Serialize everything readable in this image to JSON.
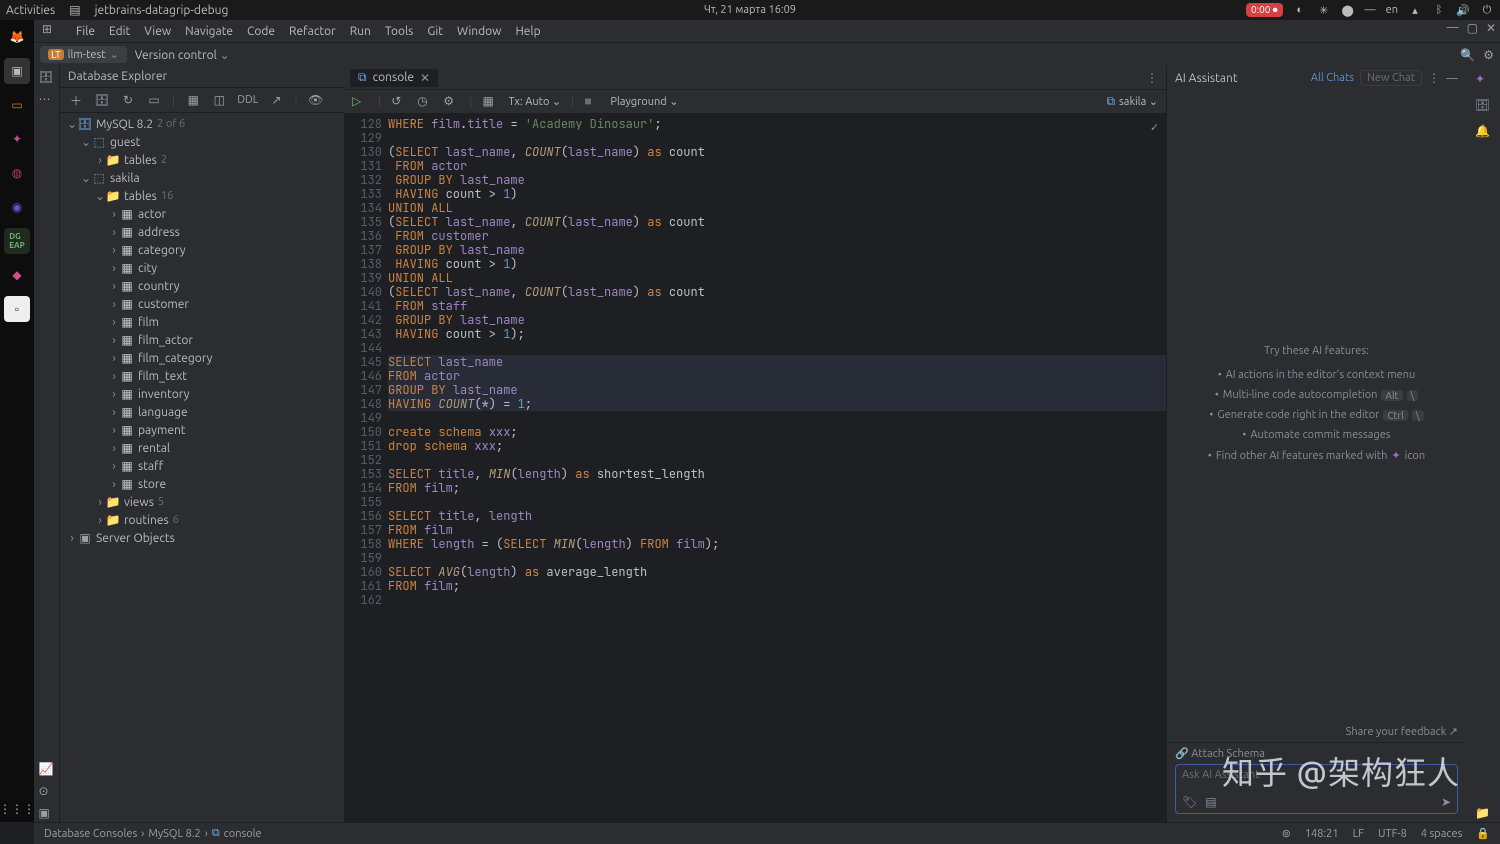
{
  "sysbar": {
    "activities": "Activities",
    "app_title": "jetbrains-datagrip-debug",
    "date": "Чт, 21 марта  16:09",
    "rec": "0:00",
    "lang": "en"
  },
  "menubar": [
    "File",
    "Edit",
    "View",
    "Navigate",
    "Code",
    "Refactor",
    "Run",
    "Tools",
    "Git",
    "Window",
    "Help"
  ],
  "navbar": {
    "project": "llm-test",
    "vcs": "Version control"
  },
  "dbexp": {
    "title": "Database Explorer",
    "tool_ddl": "DDL",
    "root": {
      "label": "MySQL 8.2",
      "suffix": "2 of 6"
    },
    "guest": {
      "label": "guest",
      "tables": {
        "label": "tables",
        "count": "2"
      }
    },
    "sakila": {
      "label": "sakila",
      "tables_label": "tables",
      "tables_count": "16",
      "tables": [
        "actor",
        "address",
        "category",
        "city",
        "country",
        "customer",
        "film",
        "film_actor",
        "film_category",
        "film_text",
        "inventory",
        "language",
        "payment",
        "rental",
        "staff",
        "store"
      ],
      "views": {
        "label": "views",
        "count": "5"
      },
      "routines": {
        "label": "routines",
        "count": "6"
      }
    },
    "server_objects": "Server Objects"
  },
  "editor": {
    "tab": "console",
    "tx": "Tx: Auto",
    "playground": "Playground",
    "session": "sakila"
  },
  "code": {
    "start": 128,
    "lines": [
      [
        [
          "kw",
          "WHERE"
        ],
        [
          "op",
          " "
        ],
        [
          "id",
          "film"
        ],
        [
          "op",
          "."
        ],
        [
          "id",
          "title"
        ],
        [
          "op",
          " = "
        ],
        [
          "str",
          "'Academy Dinosaur'"
        ],
        [
          "op",
          ";"
        ]
      ],
      [],
      [
        [
          "op",
          "("
        ],
        [
          "kw",
          "SELECT"
        ],
        [
          "op",
          " "
        ],
        [
          "id",
          "last_name"
        ],
        [
          "op",
          ", "
        ],
        [
          "fn",
          "COUNT"
        ],
        [
          "op",
          "("
        ],
        [
          "id",
          "last_name"
        ],
        [
          "op",
          ") "
        ],
        [
          "kw",
          "as"
        ],
        [
          "op",
          " count"
        ]
      ],
      [
        [
          "op",
          " "
        ],
        [
          "kw",
          "FROM"
        ],
        [
          "op",
          " "
        ],
        [
          "id",
          "actor"
        ]
      ],
      [
        [
          "op",
          " "
        ],
        [
          "kw",
          "GROUP BY"
        ],
        [
          "op",
          " "
        ],
        [
          "id",
          "last_name"
        ]
      ],
      [
        [
          "op",
          " "
        ],
        [
          "kw",
          "HAVING"
        ],
        [
          "op",
          " count > "
        ],
        [
          "num",
          "1"
        ],
        [
          "op",
          ")"
        ]
      ],
      [
        [
          "kw",
          "UNION ALL"
        ]
      ],
      [
        [
          "op",
          "("
        ],
        [
          "kw",
          "SELECT"
        ],
        [
          "op",
          " "
        ],
        [
          "id",
          "last_name"
        ],
        [
          "op",
          ", "
        ],
        [
          "fn",
          "COUNT"
        ],
        [
          "op",
          "("
        ],
        [
          "id",
          "last_name"
        ],
        [
          "op",
          ") "
        ],
        [
          "kw",
          "as"
        ],
        [
          "op",
          " count"
        ]
      ],
      [
        [
          "op",
          " "
        ],
        [
          "kw",
          "FROM"
        ],
        [
          "op",
          " "
        ],
        [
          "id",
          "customer"
        ]
      ],
      [
        [
          "op",
          " "
        ],
        [
          "kw",
          "GROUP BY"
        ],
        [
          "op",
          " "
        ],
        [
          "id",
          "last_name"
        ]
      ],
      [
        [
          "op",
          " "
        ],
        [
          "kw",
          "HAVING"
        ],
        [
          "op",
          " count > "
        ],
        [
          "num",
          "1"
        ],
        [
          "op",
          ")"
        ]
      ],
      [
        [
          "kw",
          "UNION ALL"
        ]
      ],
      [
        [
          "op",
          "("
        ],
        [
          "kw",
          "SELECT"
        ],
        [
          "op",
          " "
        ],
        [
          "id",
          "last_name"
        ],
        [
          "op",
          ", "
        ],
        [
          "fn",
          "COUNT"
        ],
        [
          "op",
          "("
        ],
        [
          "id",
          "last_name"
        ],
        [
          "op",
          ") "
        ],
        [
          "kw",
          "as"
        ],
        [
          "op",
          " count"
        ]
      ],
      [
        [
          "op",
          " "
        ],
        [
          "kw",
          "FROM"
        ],
        [
          "op",
          " "
        ],
        [
          "id",
          "staff"
        ]
      ],
      [
        [
          "op",
          " "
        ],
        [
          "kw",
          "GROUP BY"
        ],
        [
          "op",
          " "
        ],
        [
          "id",
          "last_name"
        ]
      ],
      [
        [
          "op",
          " "
        ],
        [
          "kw",
          "HAVING"
        ],
        [
          "op",
          " count > "
        ],
        [
          "num",
          "1"
        ],
        [
          "op",
          ");"
        ]
      ],
      [],
      [
        [
          "kw",
          "SELECT"
        ],
        [
          "op",
          " "
        ],
        [
          "id",
          "last_name"
        ]
      ],
      [
        [
          "kw",
          "FROM"
        ],
        [
          "op",
          " "
        ],
        [
          "id",
          "actor"
        ]
      ],
      [
        [
          "kw",
          "GROUP BY"
        ],
        [
          "op",
          " "
        ],
        [
          "id",
          "last_name"
        ]
      ],
      [
        [
          "kw",
          "HAVING"
        ],
        [
          "op",
          " "
        ],
        [
          "fn",
          "COUNT"
        ],
        [
          "op",
          "(*) = "
        ],
        [
          "num",
          "1"
        ],
        [
          "op",
          ";"
        ]
      ],
      [],
      [
        [
          "kw",
          "create schema"
        ],
        [
          "op",
          " "
        ],
        [
          "id",
          "xxx"
        ],
        [
          "op",
          ";"
        ]
      ],
      [
        [
          "kw",
          "drop schema"
        ],
        [
          "op",
          " "
        ],
        [
          "id",
          "xxx"
        ],
        [
          "op",
          ";"
        ]
      ],
      [],
      [
        [
          "kw",
          "SELECT"
        ],
        [
          "op",
          " "
        ],
        [
          "id",
          "title"
        ],
        [
          "op",
          ", "
        ],
        [
          "fn",
          "MIN"
        ],
        [
          "op",
          "("
        ],
        [
          "id",
          "length"
        ],
        [
          "op",
          ") "
        ],
        [
          "kw",
          "as"
        ],
        [
          "op",
          " shortest_length"
        ]
      ],
      [
        [
          "kw",
          "FROM"
        ],
        [
          "op",
          " "
        ],
        [
          "id",
          "film"
        ],
        [
          "op",
          ";"
        ]
      ],
      [],
      [
        [
          "kw",
          "SELECT"
        ],
        [
          "op",
          " "
        ],
        [
          "id",
          "title"
        ],
        [
          "op",
          ", "
        ],
        [
          "id",
          "length"
        ]
      ],
      [
        [
          "kw",
          "FROM"
        ],
        [
          "op",
          " "
        ],
        [
          "id",
          "film"
        ]
      ],
      [
        [
          "kw",
          "WHERE"
        ],
        [
          "op",
          " "
        ],
        [
          "id",
          "length"
        ],
        [
          "op",
          " = ("
        ],
        [
          "kw",
          "SELECT"
        ],
        [
          "op",
          " "
        ],
        [
          "fn",
          "MIN"
        ],
        [
          "op",
          "("
        ],
        [
          "id",
          "length"
        ],
        [
          "op",
          ") "
        ],
        [
          "kw",
          "FROM"
        ],
        [
          "op",
          " "
        ],
        [
          "id",
          "film"
        ],
        [
          "op",
          ");"
        ]
      ],
      [],
      [
        [
          "kw",
          "SELECT"
        ],
        [
          "op",
          " "
        ],
        [
          "fn",
          "AVG"
        ],
        [
          "op",
          "("
        ],
        [
          "id",
          "length"
        ],
        [
          "op",
          ") "
        ],
        [
          "kw",
          "as"
        ],
        [
          "op",
          " average_length"
        ]
      ],
      [
        [
          "kw",
          "FROM"
        ],
        [
          "op",
          " "
        ],
        [
          "id",
          "film"
        ],
        [
          "op",
          ";"
        ]
      ],
      []
    ],
    "highlight_rows": [
      145,
      146,
      147,
      148
    ]
  },
  "ai": {
    "title": "AI Assistant",
    "all_chats": "All Chats",
    "new_chat": "New Chat",
    "try_label": "Try these AI features:",
    "feat1": "AI actions in the editor's context menu",
    "feat2": "Multi-line code autocompletion",
    "feat2_kbd": "Alt",
    "feat3": "Generate code right in the editor",
    "feat3_kbd": "Ctrl",
    "feat4": "Automate commit messages",
    "feat5": "Find other AI features marked with",
    "feat5_suffix": "icon",
    "feedback": "Share your feedback ↗",
    "attach": "Attach Schema",
    "placeholder": "Ask AI Assistant"
  },
  "status": {
    "bc1": "Database Consoles",
    "bc2": "MySQL 8.2",
    "bc3": "console",
    "pos": "148:21",
    "le": "LF",
    "enc": "UTF-8",
    "indent": "4 spaces"
  },
  "watermark": "知乎 @架构狂人"
}
